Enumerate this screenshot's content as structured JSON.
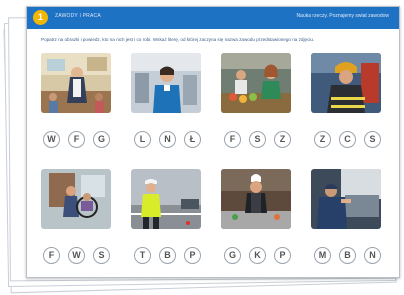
{
  "header": {
    "badge": "1",
    "title": "ZAWODY I PRACA",
    "right": "Nauka rzeczy. Poznajemy swiat zawodow"
  },
  "instruction": "Popatrz na obrazki i powiedz, kto na nich jest i co robi. Wskaż literę, od której zaczyna się nazwa zawodu przedstawionego na zdjęciu.",
  "cards": [
    {
      "subject": "teacher in classroom",
      "letters": [
        "W",
        "F",
        "G"
      ]
    },
    {
      "subject": "flight attendant at airport",
      "letters": [
        "L",
        "N",
        "Ł"
      ]
    },
    {
      "subject": "shop assistant at market",
      "letters": [
        "F",
        "S",
        "Z"
      ]
    },
    {
      "subject": "firefighter",
      "letters": [
        "Z",
        "C",
        "S"
      ]
    },
    {
      "subject": "nurse with wheelchair",
      "letters": [
        "F",
        "W",
        "S"
      ]
    },
    {
      "subject": "police officer directing traffic",
      "letters": [
        "T",
        "B",
        "P"
      ]
    },
    {
      "subject": "cook in kitchen",
      "letters": [
        "G",
        "K",
        "P"
      ]
    },
    {
      "subject": "car mechanic",
      "letters": [
        "M",
        "B",
        "N"
      ]
    }
  ],
  "colors": {
    "header": "#1e72c4",
    "badge": "#f2b705",
    "instruction_text": "#3c5d8a"
  }
}
